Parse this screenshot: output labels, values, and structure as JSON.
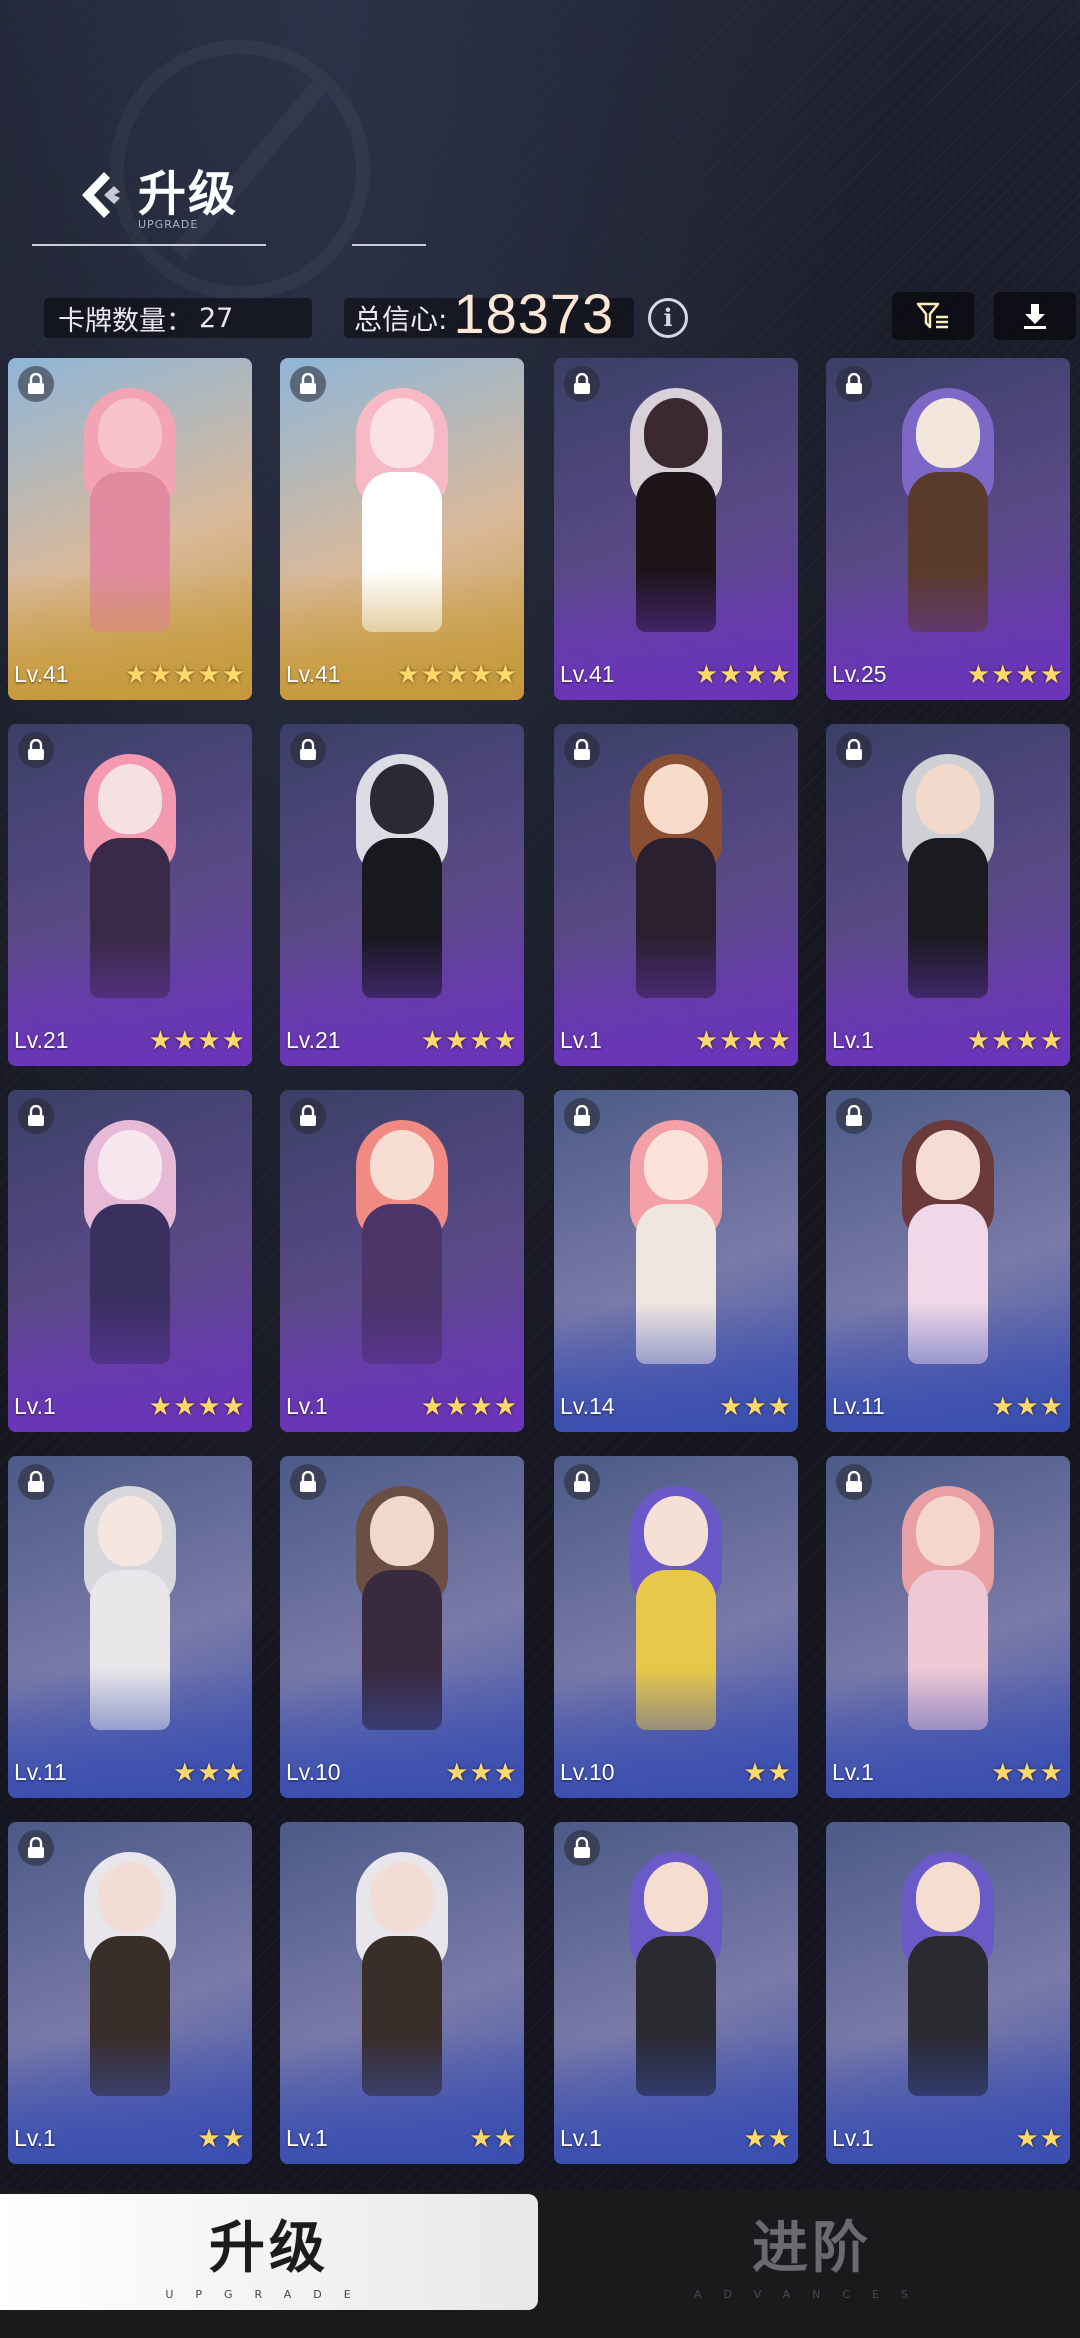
{
  "header": {
    "title": "升级",
    "subtitle": "UPGRADE",
    "cards_label": "卡牌数量：",
    "cards_count": "27",
    "trust_label": "总信心:",
    "trust_value": "18373"
  },
  "icons": {
    "title": "upgrade-logo-icon",
    "info": "info-icon",
    "filter": "filter-icon",
    "download": "download-icon",
    "lock": "lock-icon"
  },
  "colors": {
    "gold_card": "#c9a24a",
    "purple_card": "#6a35b8",
    "blue_card": "#3b4fb0",
    "star": "#ffd86a",
    "trust_value": "#fbe7d4"
  },
  "cards": [
    {
      "level": "Lv.41",
      "stars": "★★★★★",
      "tier": "gold",
      "locked": true
    },
    {
      "level": "Lv.41",
      "stars": "★★★★★",
      "tier": "gold",
      "locked": true
    },
    {
      "level": "Lv.41",
      "stars": "★★★★",
      "tier": "purple",
      "locked": true
    },
    {
      "level": "Lv.25",
      "stars": "★★★★",
      "tier": "purple",
      "locked": true
    },
    {
      "level": "Lv.21",
      "stars": "★★★★",
      "tier": "purple",
      "locked": true
    },
    {
      "level": "Lv.21",
      "stars": "★★★★",
      "tier": "purple",
      "locked": true
    },
    {
      "level": "Lv.1",
      "stars": "★★★★",
      "tier": "purple",
      "locked": true
    },
    {
      "level": "Lv.1",
      "stars": "★★★★",
      "tier": "purple",
      "locked": true
    },
    {
      "level": "Lv.1",
      "stars": "★★★★",
      "tier": "purple",
      "locked": true
    },
    {
      "level": "Lv.1",
      "stars": "★★★★",
      "tier": "purple",
      "locked": true
    },
    {
      "level": "Lv.14",
      "stars": "★★★",
      "tier": "blue",
      "locked": true
    },
    {
      "level": "Lv.11",
      "stars": "★★★",
      "tier": "blue",
      "locked": true
    },
    {
      "level": "Lv.11",
      "stars": "★★★",
      "tier": "blue",
      "locked": true
    },
    {
      "level": "Lv.10",
      "stars": "★★★",
      "tier": "blue",
      "locked": true
    },
    {
      "level": "Lv.10",
      "stars": "★★",
      "tier": "blue",
      "locked": true
    },
    {
      "level": "Lv.1",
      "stars": "★★★",
      "tier": "blue",
      "locked": true
    },
    {
      "level": "Lv.1",
      "stars": "★★",
      "tier": "blue",
      "locked": true
    },
    {
      "level": "Lv.1",
      "stars": "★★",
      "tier": "blue",
      "locked": false
    },
    {
      "level": "Lv.1",
      "stars": "★★",
      "tier": "blue",
      "locked": true
    },
    {
      "level": "Lv.1",
      "stars": "★★",
      "tier": "blue",
      "locked": false
    }
  ],
  "bottom_tabs": [
    {
      "label": "升级",
      "sub": "UPGRADE",
      "active": true
    },
    {
      "label": "进阶",
      "sub": "ADVANCES",
      "active": false
    }
  ]
}
